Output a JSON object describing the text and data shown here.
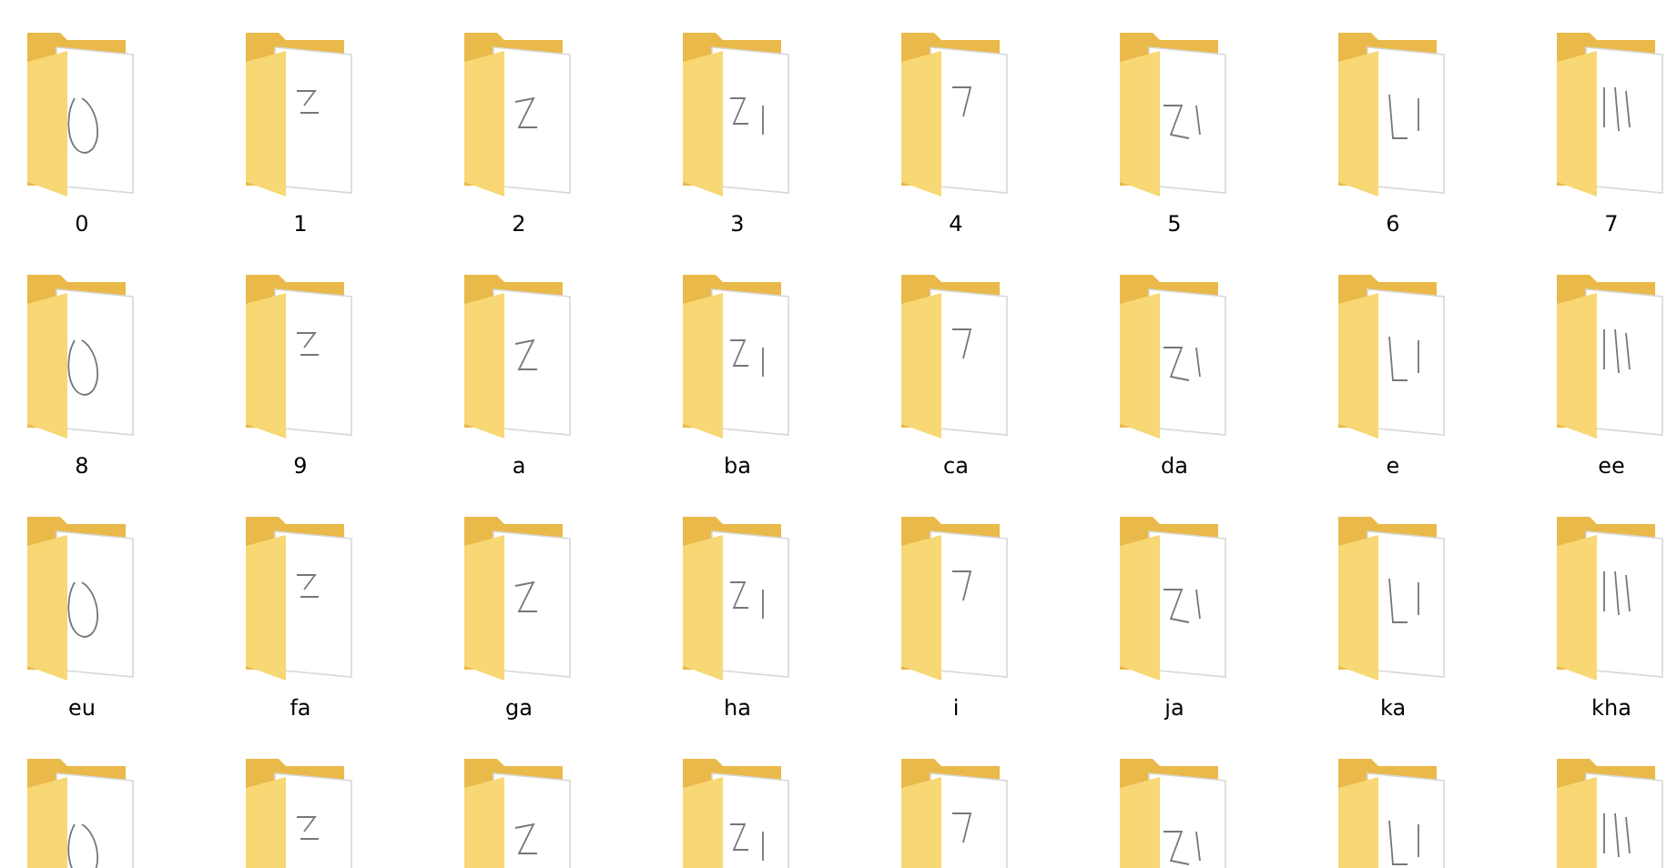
{
  "folders": [
    {
      "kind": "folder",
      "name": "0"
    },
    {
      "kind": "folder",
      "name": "1"
    },
    {
      "kind": "folder",
      "name": "2"
    },
    {
      "kind": "folder",
      "name": "3"
    },
    {
      "kind": "folder",
      "name": "4"
    },
    {
      "kind": "folder",
      "name": "5"
    },
    {
      "kind": "folder",
      "name": "6"
    },
    {
      "kind": "folder",
      "name": "7"
    },
    {
      "kind": "folder",
      "name": "8"
    },
    {
      "kind": "folder",
      "name": "9"
    },
    {
      "kind": "folder",
      "name": "a"
    },
    {
      "kind": "folder",
      "name": "ba"
    },
    {
      "kind": "folder",
      "name": "ca"
    },
    {
      "kind": "folder",
      "name": "da"
    },
    {
      "kind": "folder",
      "name": "e"
    },
    {
      "kind": "folder",
      "name": "ee"
    },
    {
      "kind": "folder",
      "name": "eu"
    },
    {
      "kind": "folder",
      "name": "fa"
    },
    {
      "kind": "folder",
      "name": "ga"
    },
    {
      "kind": "folder",
      "name": "ha"
    },
    {
      "kind": "folder",
      "name": "i"
    },
    {
      "kind": "folder",
      "name": "ja"
    },
    {
      "kind": "folder",
      "name": "ka"
    },
    {
      "kind": "folder",
      "name": "kha"
    },
    {
      "kind": "folder"
    },
    {
      "kind": "folder"
    },
    {
      "kind": "folder"
    },
    {
      "kind": "folder"
    },
    {
      "kind": "folder"
    },
    {
      "kind": "folder"
    },
    {
      "kind": "folder"
    },
    {
      "kind": "folder"
    }
  ]
}
